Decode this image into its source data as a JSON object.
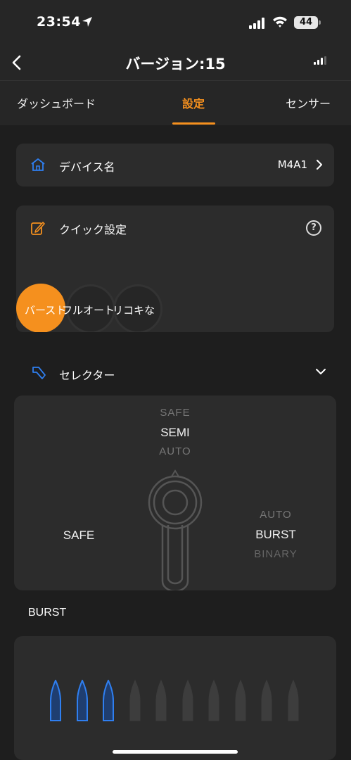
{
  "status_bar": {
    "time": "23:54",
    "battery": "44"
  },
  "nav": {
    "title": "バージョン:15"
  },
  "tabs": [
    {
      "label": "ダッシュボード"
    },
    {
      "label": "設定"
    },
    {
      "label": "センサー"
    }
  ],
  "device": {
    "label": "デバイス名",
    "value": "M4A1"
  },
  "quick_settings": {
    "label": "クイック設定",
    "help": "?",
    "modes": [
      {
        "label": "バースト"
      },
      {
        "label": "フルオート"
      },
      {
        "label": "リコキな"
      }
    ]
  },
  "selector": {
    "label": "セレクター",
    "top_options": [
      "SAFE",
      "SEMI",
      "AUTO"
    ],
    "left_option": "SAFE",
    "right_options": [
      "AUTO",
      "BURST",
      "BINARY"
    ]
  },
  "burst": {
    "heading": "BURST",
    "bullets_total": 10,
    "bullets_active": 3
  },
  "colors": {
    "accent": "#f5901e",
    "active_blue": "#2f7ff0",
    "card": "#2c2c2c",
    "background": "#1e1e1e"
  }
}
